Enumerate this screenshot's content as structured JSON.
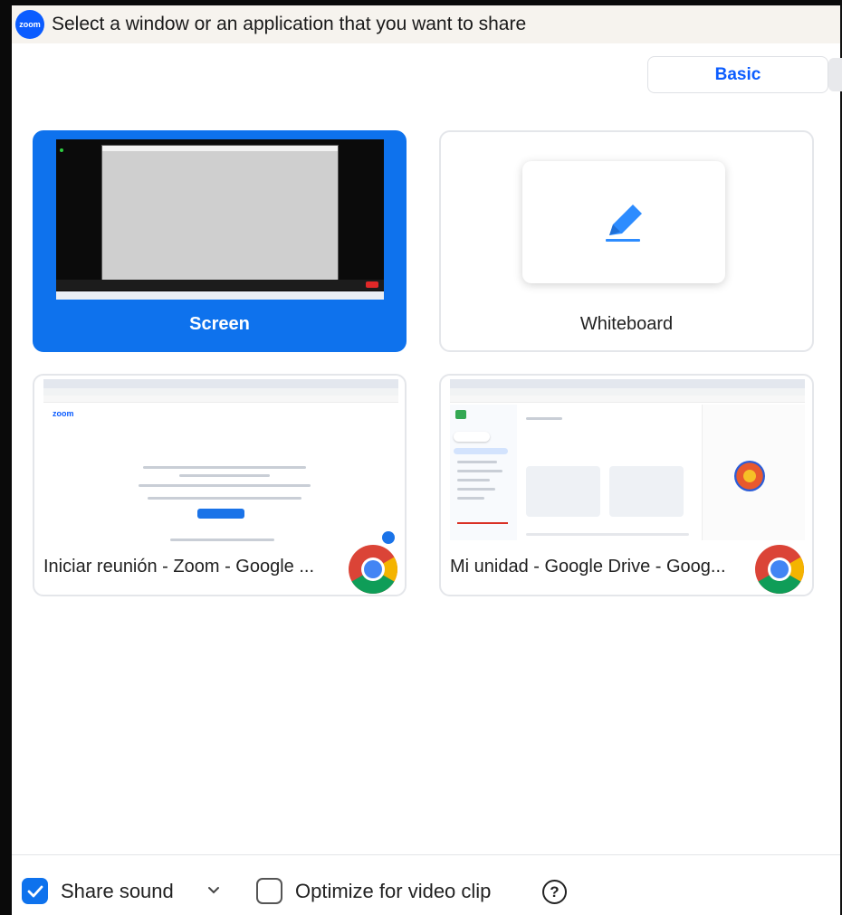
{
  "window": {
    "logo_text": "zoom",
    "title": "Select a window or an application that you want to share"
  },
  "tabs": {
    "basic_label": "Basic"
  },
  "sources": [
    {
      "label": "Screen",
      "selected": true
    },
    {
      "label": "Whiteboard",
      "selected": false
    },
    {
      "label": "Iniciar reunión - Zoom - Google ...",
      "app_icon": "chrome-icon",
      "thumb_brand": "zoom"
    },
    {
      "label": "Mi unidad - Google Drive - Goog...",
      "app_icon": "chrome-icon"
    }
  ],
  "options": {
    "share_sound_label": "Share sound",
    "share_sound_checked": true,
    "optimize_label": "Optimize for video clip",
    "optimize_checked": false,
    "help_symbol": "?"
  },
  "colors": {
    "accent": "#0e72ed",
    "brand_blue": "#0b5cff"
  }
}
